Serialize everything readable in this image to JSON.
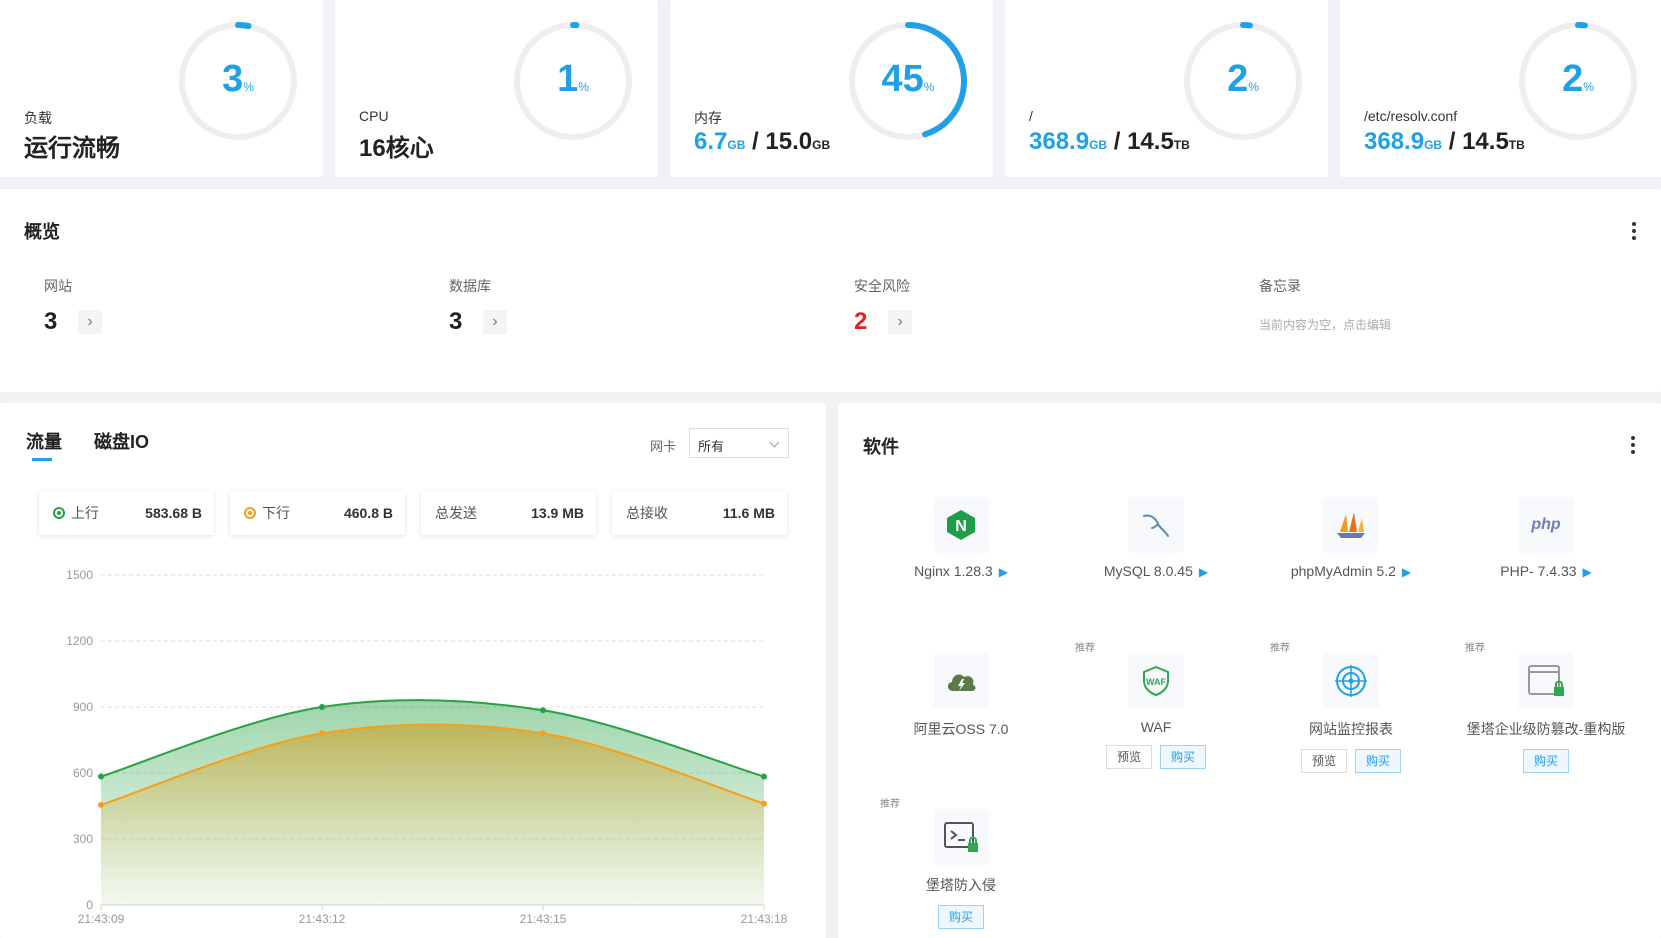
{
  "stats": [
    {
      "label": "负载",
      "value_text": "运行流畅",
      "percent": 3,
      "percent_sym": "%"
    },
    {
      "label": "CPU",
      "value_text": "16核心",
      "percent": 1,
      "percent_sym": "%"
    },
    {
      "label": "内存",
      "used": "6.7",
      "used_unit": "GB",
      "sep": " / ",
      "total": "15.0",
      "total_unit": "GB",
      "percent": 45,
      "percent_sym": "%"
    },
    {
      "label": "/",
      "used": "368.9",
      "used_unit": "GB",
      "sep": " / ",
      "total": "14.5",
      "total_unit": "TB",
      "percent": 2,
      "percent_sym": "%"
    },
    {
      "label": "/etc/resolv.conf",
      "used": "368.9",
      "used_unit": "GB",
      "sep": " / ",
      "total": "14.5",
      "total_unit": "TB",
      "percent": 2,
      "percent_sym": "%"
    }
  ],
  "overview": {
    "title": "概览",
    "items": [
      {
        "label": "网站",
        "value": "3",
        "arrow": "›"
      },
      {
        "label": "数据库",
        "value": "3",
        "arrow": "›"
      },
      {
        "label": "安全风险",
        "value": "2",
        "arrow": "›"
      }
    ],
    "memo": {
      "label": "备忘录",
      "text": "当前内容为空，点击编辑"
    }
  },
  "traffic": {
    "tabs": [
      "流量",
      "磁盘IO"
    ],
    "nic_label": "网卡",
    "nic_selected": "所有",
    "chips": [
      {
        "label": "上行",
        "value": "583.68 B"
      },
      {
        "label": "下行",
        "value": "460.8 B"
      },
      {
        "label": "总发送",
        "value": "13.9 MB"
      },
      {
        "label": "总接收",
        "value": "11.6 MB"
      }
    ]
  },
  "chart_data": {
    "type": "area",
    "categories": [
      "21:43:09",
      "21:43:12",
      "21:43:15",
      "21:43:18"
    ],
    "yticks": [
      0,
      300,
      600,
      900,
      1200,
      1500
    ],
    "ylim": [
      0,
      1500
    ],
    "grid": true,
    "series": [
      {
        "name": "上行",
        "color": "#27a243",
        "values": [
          584,
          900,
          885,
          583.68
        ]
      },
      {
        "name": "下行",
        "color": "#f59f1a",
        "values": [
          455,
          780,
          780,
          460.8
        ]
      }
    ]
  },
  "software": {
    "title": "软件",
    "recommend_label": "推荐",
    "items": [
      {
        "name": "Nginx 1.28.3",
        "play": "▶"
      },
      {
        "name": "MySQL 8.0.45",
        "play": "▶"
      },
      {
        "name": "phpMyAdmin 5.2",
        "play": "▶"
      },
      {
        "name": "PHP- 7.4.33",
        "play": "▶",
        "logo": "php"
      },
      {
        "name": "阿里云OSS 7.0"
      },
      {
        "name": "WAF",
        "preview": "预览",
        "buy": "购买",
        "logo": "WAF"
      },
      {
        "name": "网站监控报表",
        "preview": "预览",
        "buy": "购买"
      },
      {
        "name": "堡塔企业级防篡改-重构版",
        "buy": "购买"
      },
      {
        "name": "堡塔防入侵",
        "buy": "购买"
      }
    ]
  },
  "colors": {
    "accent": "#20a0e6",
    "danger": "#e02424",
    "ring_track": "#eeeeee"
  }
}
